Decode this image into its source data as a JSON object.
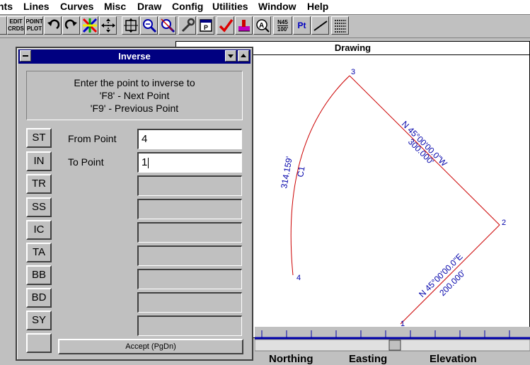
{
  "menu": [
    "nts",
    "Lines",
    "Curves",
    "Misc",
    "Draw",
    "Config",
    "Utilities",
    "Window",
    "Help"
  ],
  "toolbar": {
    "edit_crds": "EDIT CRDS",
    "point_plot": "POINT PLOT",
    "bearing_top": "N45",
    "bearing_bottom": "100'",
    "pt": "Pt"
  },
  "drawing": {
    "title": "Drawing",
    "points": [
      "1",
      "2",
      "3",
      "4"
    ],
    "labels": {
      "line32_bearing": "N 45°00'00.0\"W",
      "line32_distance": "300.000'",
      "line12_bearing": "N 45°00'00.0\"E",
      "line12_distance": "200.000'",
      "curve_length": "314.159'",
      "curve_name": "C1"
    }
  },
  "dialog": {
    "title": "Inverse",
    "prompt_line1": "Enter the point to inverse to",
    "prompt_line2": "'F8' - Next Point",
    "prompt_line3": "'F9' - Previous Point",
    "side_buttons": [
      "ST",
      "IN",
      "TR",
      "SS",
      "IC",
      "TA",
      "BB",
      "BD",
      "SY",
      ""
    ],
    "from_label": "From Point",
    "from_value": "4",
    "to_label": "To Point",
    "to_value": "1",
    "accept": "Accept (PgDn)"
  },
  "columns": [
    "Northing",
    "Easting",
    "Elevation"
  ],
  "colors": {
    "line": "#cc0000",
    "label": "#0000aa",
    "titlebar": "#000080"
  }
}
